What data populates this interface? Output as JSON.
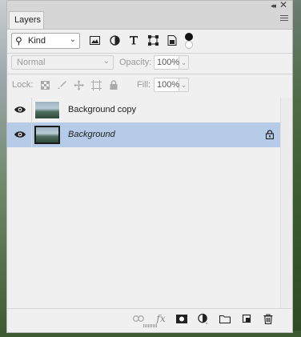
{
  "panel": {
    "tab_label": "Layers",
    "collapse_glyph": "◂◂",
    "close_glyph": "✕"
  },
  "filter": {
    "kind_value": "Kind",
    "search_glyph": "⚲",
    "chevron": "⌄",
    "icons": [
      "image-filter-icon",
      "adjustment-filter-icon",
      "type-filter-icon",
      "shape-filter-icon",
      "smart-object-filter-icon",
      "filter-toggle-icon"
    ]
  },
  "blend": {
    "mode_value": "Normal",
    "opacity_label": "Opacity:",
    "opacity_value": "100%",
    "fill_label": "Fill:",
    "fill_value": "100%"
  },
  "lock": {
    "label": "Lock:",
    "icons": [
      "lock-transparent-icon",
      "lock-image-icon",
      "lock-position-icon",
      "lock-artboard-icon",
      "lock-all-icon"
    ]
  },
  "layers": [
    {
      "name": "Background copy",
      "visible": true,
      "selected": false,
      "locked": false
    },
    {
      "name": "Background",
      "visible": true,
      "selected": true,
      "locked": true
    }
  ],
  "footer": {
    "icons": [
      "link-layers-icon",
      "fx-icon",
      "layer-mask-icon",
      "adjustment-layer-icon",
      "new-group-icon",
      "new-layer-icon",
      "delete-layer-icon"
    ],
    "fx_text": "fx"
  },
  "colors": {
    "selected_row": "#b5cbe8",
    "panel_bg": "#f0f0f0"
  }
}
